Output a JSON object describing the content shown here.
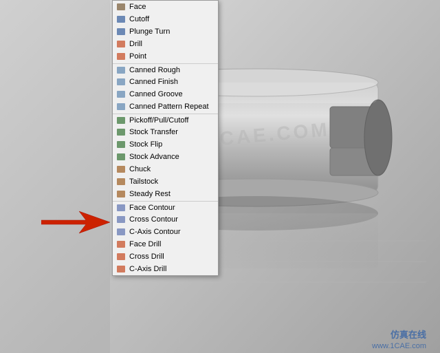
{
  "scene": {
    "watermark": "1CAE.COM",
    "brand_cn": "仿真在线",
    "brand_url": "www.1CAE.com"
  },
  "menu": {
    "items": [
      {
        "id": "face",
        "label": "Face",
        "icon": "face-icon",
        "separator": false
      },
      {
        "id": "cutoff",
        "label": "Cutoff",
        "icon": "cutoff-icon",
        "separator": false
      },
      {
        "id": "plunge-turn",
        "label": "Plunge Turn",
        "icon": "plunge-turn-icon",
        "separator": false
      },
      {
        "id": "drill",
        "label": "Drill",
        "icon": "drill-icon",
        "separator": false
      },
      {
        "id": "point",
        "label": "Point",
        "icon": "point-icon",
        "separator": false
      },
      {
        "id": "canned-rough",
        "label": "Canned Rough",
        "icon": "canned-rough-icon",
        "separator": true
      },
      {
        "id": "canned-finish",
        "label": "Canned Finish",
        "icon": "canned-finish-icon",
        "separator": false
      },
      {
        "id": "canned-groove",
        "label": "Canned Groove",
        "icon": "canned-groove-icon",
        "separator": false
      },
      {
        "id": "canned-pattern",
        "label": "Canned Pattern Repeat",
        "icon": "canned-pattern-icon",
        "separator": false
      },
      {
        "id": "pickoff",
        "label": "Pickoff/Pull/Cutoff",
        "icon": "pickoff-icon",
        "separator": true
      },
      {
        "id": "stock-transfer",
        "label": "Stock Transfer",
        "icon": "stock-transfer-icon",
        "separator": false
      },
      {
        "id": "stock-flip",
        "label": "Stock Flip",
        "icon": "stock-flip-icon",
        "separator": false
      },
      {
        "id": "stock-advance",
        "label": "Stock Advance",
        "icon": "stock-advance-icon",
        "separator": false
      },
      {
        "id": "chuck",
        "label": "Chuck",
        "icon": "chuck-icon",
        "separator": false
      },
      {
        "id": "tailstock",
        "label": "Tailstock",
        "icon": "tailstock-icon",
        "separator": false
      },
      {
        "id": "steady-rest",
        "label": "Steady Rest",
        "icon": "steady-rest-icon",
        "separator": false
      },
      {
        "id": "face-contour",
        "label": "Face Contour",
        "icon": "face-contour-icon",
        "separator": true
      },
      {
        "id": "cross-contour",
        "label": "Cross Contour",
        "icon": "cross-contour-icon",
        "separator": false
      },
      {
        "id": "c-axis-contour",
        "label": "C-Axis Contour",
        "icon": "c-axis-contour-icon",
        "separator": false
      },
      {
        "id": "face-drill",
        "label": "Face Drill",
        "icon": "face-drill-icon",
        "separator": false
      },
      {
        "id": "cross-drill",
        "label": "Cross Drill",
        "icon": "cross-drill-icon",
        "separator": false
      },
      {
        "id": "c-axis-drill",
        "label": "C-Axis Drill",
        "icon": "c-axis-drill-icon",
        "separator": false
      }
    ]
  },
  "arrow": {
    "pointing_to": "c-axis-drill"
  }
}
